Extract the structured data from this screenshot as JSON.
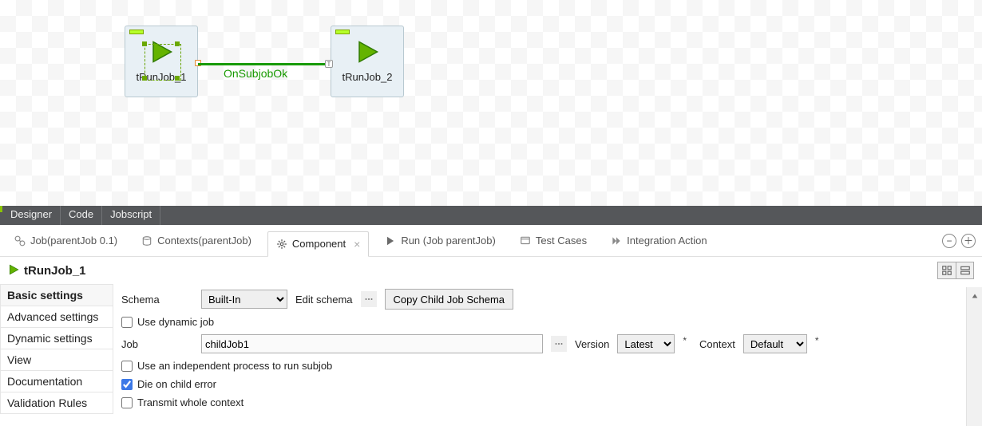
{
  "canvas": {
    "component1_label": "tRunJob_1",
    "component2_label": "tRunJob_2",
    "connector_label": "OnSubjobOk"
  },
  "designer_tabs": {
    "t1": "Designer",
    "t2": "Code",
    "t3": "Jobscript"
  },
  "sec_tabs": {
    "job": "Job(parentJob 0.1)",
    "contexts": "Contexts(parentJob)",
    "component": "Component",
    "run": "Run (Job parentJob)",
    "test_cases": "Test Cases",
    "integration": "Integration Action"
  },
  "component_panel": {
    "title": "tRunJob_1",
    "side": {
      "basic": "Basic settings",
      "advanced": "Advanced settings",
      "dynamic": "Dynamic settings",
      "view": "View",
      "doc": "Documentation",
      "validation": "Validation Rules"
    },
    "form": {
      "schema_label": "Schema",
      "schema_value": "Built-In",
      "edit_schema": "Edit schema",
      "copy_child": "Copy Child Job Schema",
      "use_dynamic_job": "Use dynamic job",
      "job_label": "Job",
      "job_value": "childJob1",
      "version_label": "Version",
      "version_value": "Latest",
      "context_label": "Context",
      "context_value": "Default",
      "use_independent": "Use an independent process to run subjob",
      "die_on_error": "Die on child error",
      "transmit_context": "Transmit whole context"
    }
  }
}
